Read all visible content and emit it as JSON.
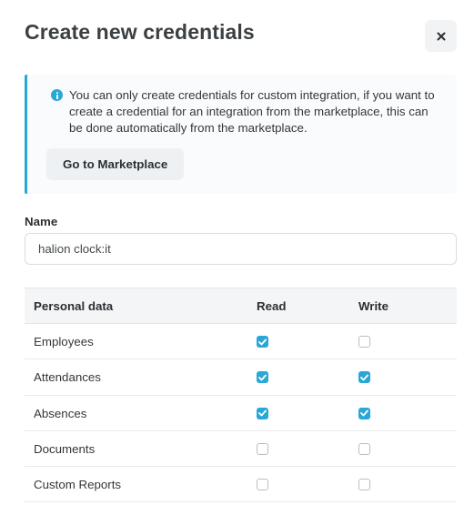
{
  "dialog": {
    "title": "Create new credentials",
    "close_icon": "close-icon"
  },
  "info": {
    "icon": "info-icon",
    "text": "You can only create credentials for custom integration, if you want to create a credential for an integration from the marketplace, this can be done automatically from the marketplace.",
    "button_label": "Go to Marketplace"
  },
  "name": {
    "label": "Name",
    "value": "halion clock:it"
  },
  "permissions": {
    "headers": [
      "Personal data",
      "Read",
      "Write"
    ],
    "rows": [
      {
        "label": "Employees",
        "read": true,
        "write": false
      },
      {
        "label": "Attendances",
        "read": true,
        "write": true
      },
      {
        "label": "Absences",
        "read": true,
        "write": true
      },
      {
        "label": "Documents",
        "read": false,
        "write": false
      },
      {
        "label": "Custom Reports",
        "read": false,
        "write": false
      }
    ]
  },
  "colors": {
    "accent": "#29a7d6",
    "button_bg": "#eef1f4",
    "header_bg": "#f3f5f7"
  }
}
